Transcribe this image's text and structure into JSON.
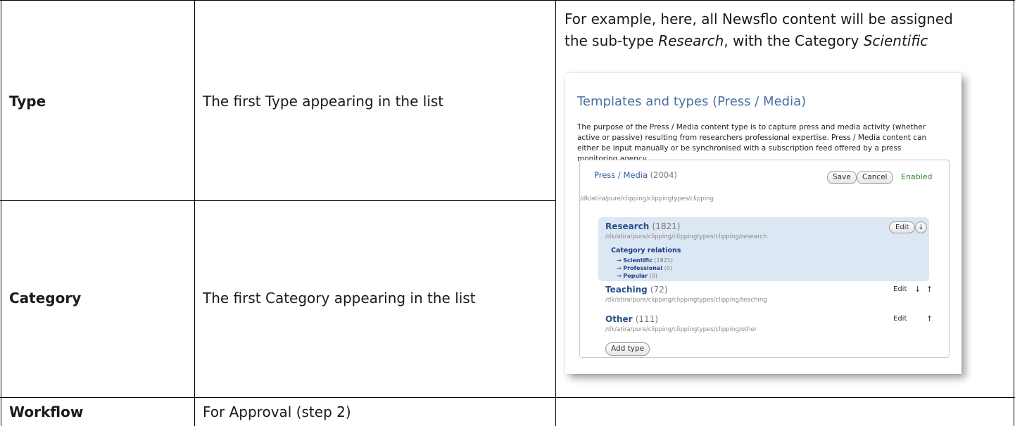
{
  "rows": [
    {
      "label": "Type",
      "value": "The first Type appearing in the list"
    },
    {
      "label": "Category",
      "value": "The first Category appearing in the list"
    },
    {
      "label": "Workflow",
      "value": "For Approval (step 2)"
    }
  ],
  "example": {
    "line1": "For example, here, all Newsflo content will be assigned",
    "line2_prefix": "the sub-type ",
    "line2_em1": "Research",
    "line2_mid": ", with the Category ",
    "line2_em2": "Scientific"
  },
  "screenshot": {
    "title": "Templates and types (Press / Media)",
    "description": "The purpose of the Press / Media content type is to capture press and media activity (whether active or passive) resulting from researchers professional expertise. Press / Media content can either be input manually or be synchronised with a subscription feed offered by a press monitoring agency",
    "panel": {
      "title": "Press / Media",
      "count": "(2004)",
      "save_label": "Save",
      "cancel_label": "Cancel",
      "status": "Enabled",
      "path": "/dk/atira/pure/clipping/clippingtypes/clipping"
    },
    "types": [
      {
        "name": "Research",
        "count": "(1821)",
        "path": "/dk/atira/pure/clipping/clippingtypes/clipping/research",
        "edit_label": "Edit",
        "category_relations_label": "Category relations",
        "categories": [
          {
            "name": "Scientific",
            "count": "(1821)"
          },
          {
            "name": "Professional",
            "count": "(0)"
          },
          {
            "name": "Popular",
            "count": "(0)"
          }
        ]
      },
      {
        "name": "Teaching",
        "count": "(72)",
        "path": "/dk/atira/pure/clipping/clippingtypes/clipping/teaching",
        "edit_label": "Edit"
      },
      {
        "name": "Other",
        "count": "(111)",
        "path": "/dk/atira/pure/clipping/clippingtypes/clipping/other",
        "edit_label": "Edit"
      }
    ],
    "add_type_label": "Add type",
    "arrow_down": "↓",
    "arrow_up": "↑",
    "cat_arrow": "→"
  }
}
